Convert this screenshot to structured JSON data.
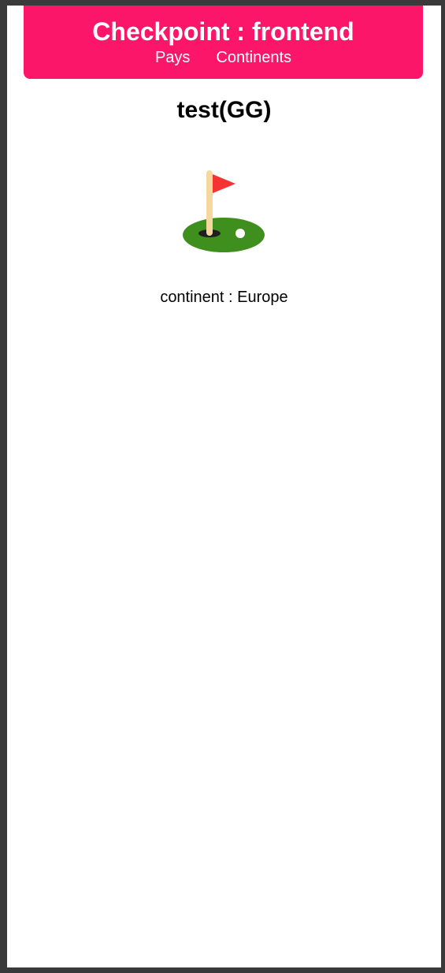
{
  "header": {
    "title": "Checkpoint : frontend",
    "nav": [
      {
        "label": "Pays"
      },
      {
        "label": "Continents"
      }
    ],
    "background_color": "#fc166a"
  },
  "country": {
    "title": "test(GG)",
    "emoji_icon": "flag-in-hole-icon",
    "continent_label": "continent :",
    "continent_value": "Europe"
  }
}
